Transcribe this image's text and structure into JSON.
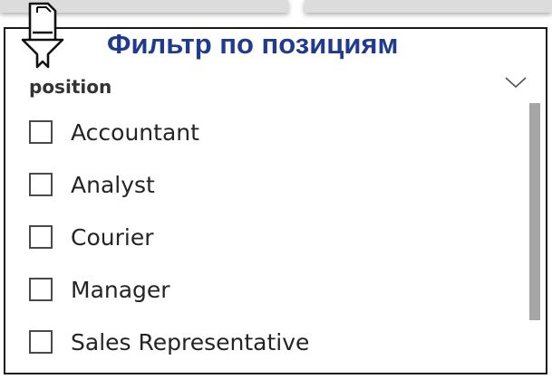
{
  "slicer": {
    "title": "Фильтр по позициям",
    "field_label": "position",
    "items": [
      {
        "label": "Accountant",
        "checked": false
      },
      {
        "label": "Analyst",
        "checked": false
      },
      {
        "label": "Courier",
        "checked": false
      },
      {
        "label": "Manager",
        "checked": false
      },
      {
        "label": "Sales Representative",
        "checked": false
      }
    ],
    "icons": {
      "filter": "filter-icon",
      "expand": "chevron-down-icon"
    },
    "colors": {
      "title": "#1f3a8f",
      "text": "#252423",
      "border": "#1a1a1a",
      "scrollbar": "#a6a6a6"
    }
  }
}
